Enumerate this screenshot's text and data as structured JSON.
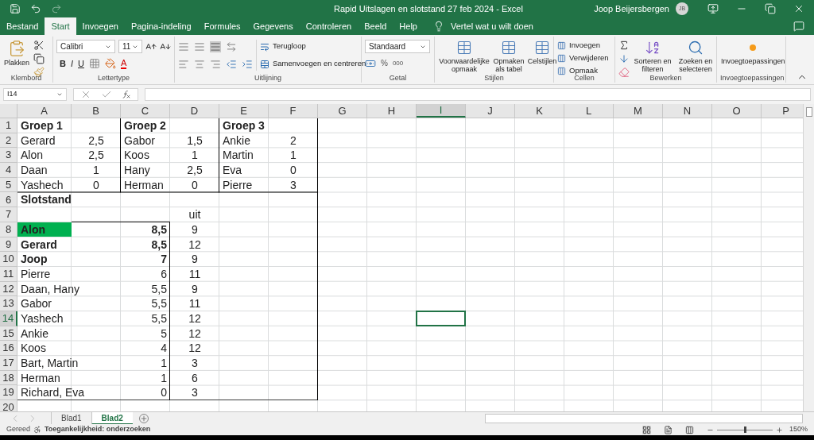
{
  "window": {
    "title": "Rapid Uitslagen en slotstand 27 feb 2024  -  Excel",
    "user": "Joop Beijersbergen",
    "avatar": "JB"
  },
  "tabs": [
    {
      "label": "Bestand",
      "selected": false
    },
    {
      "label": "Start",
      "selected": true
    },
    {
      "label": "Invoegen",
      "selected": false
    },
    {
      "label": "Pagina-indeling",
      "selected": false
    },
    {
      "label": "Formules",
      "selected": false
    },
    {
      "label": "Gegevens",
      "selected": false
    },
    {
      "label": "Controleren",
      "selected": false
    },
    {
      "label": "Beeld",
      "selected": false
    },
    {
      "label": "Help",
      "selected": false
    }
  ],
  "tell_me": "Vertel wat u wilt doen",
  "ribbon": {
    "clipboard": {
      "paste": "Plakken",
      "label": "Klembord"
    },
    "font": {
      "name": "Calibri",
      "size": "11",
      "bold": "B",
      "italic": "I",
      "underline": "U",
      "font_color": "A",
      "label": "Lettertype"
    },
    "alignment": {
      "wrap": "Terugloop",
      "merge": "Samenvoegen en centreren",
      "label": "Uitlijning"
    },
    "number": {
      "format": "Standaard",
      "percent": "%",
      "thousands": "000",
      "label": "Getal"
    },
    "styles": {
      "buttons": [
        "Voorwaardelijke opmaak",
        "Opmaken als tabel",
        "Celstijlen"
      ],
      "label": "Stijlen"
    },
    "cells": {
      "buttons": [
        "Invoegen",
        "Verwijderen",
        "Opmaak"
      ],
      "label": "Cellen"
    },
    "editing": {
      "buttons": [
        "Sorteren en filteren",
        "Zoeken en selecteren"
      ],
      "label": "Bewerken"
    },
    "addins": {
      "button": "Invoegtoepassingen",
      "label": "Invoegtoepassingen"
    }
  },
  "formula_bar": {
    "name_box": "I14"
  },
  "sheet": {
    "columns": [
      {
        "label": "A",
        "selected": false
      },
      {
        "label": "B",
        "selected": false
      },
      {
        "label": "C",
        "selected": false
      },
      {
        "label": "D",
        "selected": false
      },
      {
        "label": "E",
        "selected": false
      },
      {
        "label": "F",
        "selected": false
      },
      {
        "label": "G",
        "selected": false
      },
      {
        "label": "H",
        "selected": false
      },
      {
        "label": "I",
        "selected": true
      },
      {
        "label": "J",
        "selected": false
      },
      {
        "label": "K",
        "selected": false
      },
      {
        "label": "L",
        "selected": false
      },
      {
        "label": "M",
        "selected": false
      },
      {
        "label": "N",
        "selected": false
      },
      {
        "label": "O",
        "selected": false
      },
      {
        "label": "P",
        "selected": false
      }
    ],
    "rows": [
      {
        "label": "1",
        "selected": false,
        "cells": [
          {
            "text": "Groep 1",
            "kind": "text",
            "bold": true,
            "highlighted": false
          },
          null,
          {
            "text": "Groep 2",
            "kind": "text",
            "bold": true,
            "highlighted": false
          },
          null,
          {
            "text": "Groep 3",
            "kind": "text",
            "bold": true,
            "highlighted": false
          },
          null
        ]
      },
      {
        "label": "2",
        "selected": false,
        "cells": [
          {
            "text": "Gerard",
            "kind": "text",
            "bold": false,
            "highlighted": false
          },
          {
            "text": "2,5",
            "kind": "centered",
            "bold": false,
            "highlighted": false
          },
          {
            "text": "Gabor",
            "kind": "text",
            "bold": false,
            "highlighted": false
          },
          {
            "text": "1,5",
            "kind": "centered",
            "bold": false,
            "highlighted": false
          },
          {
            "text": "Ankie",
            "kind": "text",
            "bold": false,
            "highlighted": false
          },
          {
            "text": "2",
            "kind": "centered",
            "bold": false,
            "highlighted": false
          }
        ]
      },
      {
        "label": "3",
        "selected": false,
        "cells": [
          {
            "text": "Alon",
            "kind": "text",
            "bold": false,
            "highlighted": false
          },
          {
            "text": "2,5",
            "kind": "centered",
            "bold": false,
            "highlighted": false
          },
          {
            "text": "Koos",
            "kind": "text",
            "bold": false,
            "highlighted": false
          },
          {
            "text": "1",
            "kind": "centered",
            "bold": false,
            "highlighted": false
          },
          {
            "text": "Martin",
            "kind": "text",
            "bold": false,
            "highlighted": false
          },
          {
            "text": "1",
            "kind": "centered",
            "bold": false,
            "highlighted": false
          }
        ]
      },
      {
        "label": "4",
        "selected": false,
        "cells": [
          {
            "text": "Daan",
            "kind": "text",
            "bold": false,
            "highlighted": false
          },
          {
            "text": "1",
            "kind": "centered",
            "bold": false,
            "highlighted": false
          },
          {
            "text": "Hany",
            "kind": "text",
            "bold": false,
            "highlighted": false
          },
          {
            "text": "2,5",
            "kind": "centered",
            "bold": false,
            "highlighted": false
          },
          {
            "text": "Eva",
            "kind": "text",
            "bold": false,
            "highlighted": false
          },
          {
            "text": "0",
            "kind": "centered",
            "bold": false,
            "highlighted": false
          }
        ]
      },
      {
        "label": "5",
        "selected": false,
        "cells": [
          {
            "text": "Yashech",
            "kind": "text",
            "bold": false,
            "highlighted": false
          },
          {
            "text": "0",
            "kind": "centered",
            "bold": false,
            "highlighted": false
          },
          {
            "text": "Herman",
            "kind": "text",
            "bold": false,
            "highlighted": false
          },
          {
            "text": "0",
            "kind": "centered",
            "bold": false,
            "highlighted": false
          },
          {
            "text": "Pierre",
            "kind": "text",
            "bold": false,
            "highlighted": false
          },
          {
            "text": "3",
            "kind": "centered",
            "bold": false,
            "highlighted": false
          }
        ]
      },
      {
        "label": "6",
        "selected": false,
        "cells": [
          {
            "text": "Slotstand",
            "kind": "text",
            "bold": true,
            "highlighted": false
          }
        ]
      },
      {
        "label": "7",
        "selected": false,
        "cells": [
          null,
          null,
          null,
          {
            "text": "uit",
            "kind": "centered",
            "bold": false,
            "highlighted": false
          }
        ]
      },
      {
        "label": "8",
        "selected": false,
        "cells": [
          {
            "text": "Alon",
            "kind": "text",
            "bold": true,
            "highlighted": true
          },
          null,
          {
            "text": "8,5",
            "kind": "number",
            "bold": true,
            "highlighted": false
          },
          {
            "text": "9",
            "kind": "centered",
            "bold": false,
            "highlighted": false
          }
        ]
      },
      {
        "label": "9",
        "selected": false,
        "cells": [
          {
            "text": "Gerard",
            "kind": "text",
            "bold": true,
            "highlighted": false
          },
          null,
          {
            "text": "8,5",
            "kind": "number",
            "bold": true,
            "highlighted": false
          },
          {
            "text": "12",
            "kind": "centered",
            "bold": false,
            "highlighted": false
          }
        ]
      },
      {
        "label": "10",
        "selected": false,
        "cells": [
          {
            "text": "Joop",
            "kind": "text",
            "bold": true,
            "highlighted": false
          },
          null,
          {
            "text": "7",
            "kind": "number",
            "bold": true,
            "highlighted": false
          },
          {
            "text": "9",
            "kind": "centered",
            "bold": false,
            "highlighted": false
          }
        ]
      },
      {
        "label": "11",
        "selected": false,
        "cells": [
          {
            "text": "Pierre",
            "kind": "text",
            "bold": false,
            "highlighted": false
          },
          null,
          {
            "text": "6",
            "kind": "number",
            "bold": false,
            "highlighted": false
          },
          {
            "text": "11",
            "kind": "centered",
            "bold": false,
            "highlighted": false
          }
        ]
      },
      {
        "label": "12",
        "selected": false,
        "cells": [
          {
            "text": "Daan, Hany",
            "kind": "text",
            "bold": false,
            "highlighted": false
          },
          null,
          {
            "text": "5,5",
            "kind": "number",
            "bold": false,
            "highlighted": false
          },
          {
            "text": "9",
            "kind": "centered",
            "bold": false,
            "highlighted": false
          }
        ]
      },
      {
        "label": "13",
        "selected": false,
        "cells": [
          {
            "text": "Gabor",
            "kind": "text",
            "bold": false,
            "highlighted": false
          },
          null,
          {
            "text": "5,5",
            "kind": "number",
            "bold": false,
            "highlighted": false
          },
          {
            "text": "11",
            "kind": "centered",
            "bold": false,
            "highlighted": false
          }
        ]
      },
      {
        "label": "14",
        "selected": true,
        "cells": [
          {
            "text": "Yashech",
            "kind": "text",
            "bold": false,
            "highlighted": false
          },
          null,
          {
            "text": "5,5",
            "kind": "number",
            "bold": false,
            "highlighted": false
          },
          {
            "text": "12",
            "kind": "centered",
            "bold": false,
            "highlighted": false
          }
        ]
      },
      {
        "label": "15",
        "selected": false,
        "cells": [
          {
            "text": "Ankie",
            "kind": "text",
            "bold": false,
            "highlighted": false
          },
          null,
          {
            "text": "5",
            "kind": "number",
            "bold": false,
            "highlighted": false
          },
          {
            "text": "12",
            "kind": "centered",
            "bold": false,
            "highlighted": false
          }
        ]
      },
      {
        "label": "16",
        "selected": false,
        "cells": [
          {
            "text": "Koos",
            "kind": "text",
            "bold": false,
            "highlighted": false
          },
          null,
          {
            "text": "4",
            "kind": "number",
            "bold": false,
            "highlighted": false
          },
          {
            "text": "12",
            "kind": "centered",
            "bold": false,
            "highlighted": false
          }
        ]
      },
      {
        "label": "17",
        "selected": false,
        "cells": [
          {
            "text": "Bart, Martin",
            "kind": "text",
            "bold": false,
            "highlighted": false
          },
          null,
          {
            "text": "1",
            "kind": "number",
            "bold": false,
            "highlighted": false
          },
          {
            "text": "3",
            "kind": "centered",
            "bold": false,
            "highlighted": false
          }
        ]
      },
      {
        "label": "18",
        "selected": false,
        "cells": [
          {
            "text": "Herman",
            "kind": "text",
            "bold": false,
            "highlighted": false
          },
          null,
          {
            "text": "1",
            "kind": "number",
            "bold": false,
            "highlighted": false
          },
          {
            "text": "6",
            "kind": "centered",
            "bold": false,
            "highlighted": false
          }
        ]
      },
      {
        "label": "19",
        "selected": false,
        "cells": [
          {
            "text": "Richard, Eva",
            "kind": "text",
            "bold": false,
            "highlighted": false
          },
          null,
          {
            "text": "0",
            "kind": "number",
            "bold": false,
            "highlighted": false
          },
          {
            "text": "3",
            "kind": "centered",
            "bold": false,
            "highlighted": false
          }
        ]
      },
      {
        "label": "20",
        "selected": false,
        "cells": []
      }
    ]
  },
  "sheet_tabs": [
    {
      "label": "Blad1",
      "selected": false
    },
    {
      "label": "Blad2",
      "selected": true
    }
  ],
  "status_bar": {
    "ready": "Gereed",
    "accessibility": "Toegankelijkheid: onderzoeken",
    "zoom": "150%",
    "zoom_level": {
      "level": 0.5
    }
  }
}
